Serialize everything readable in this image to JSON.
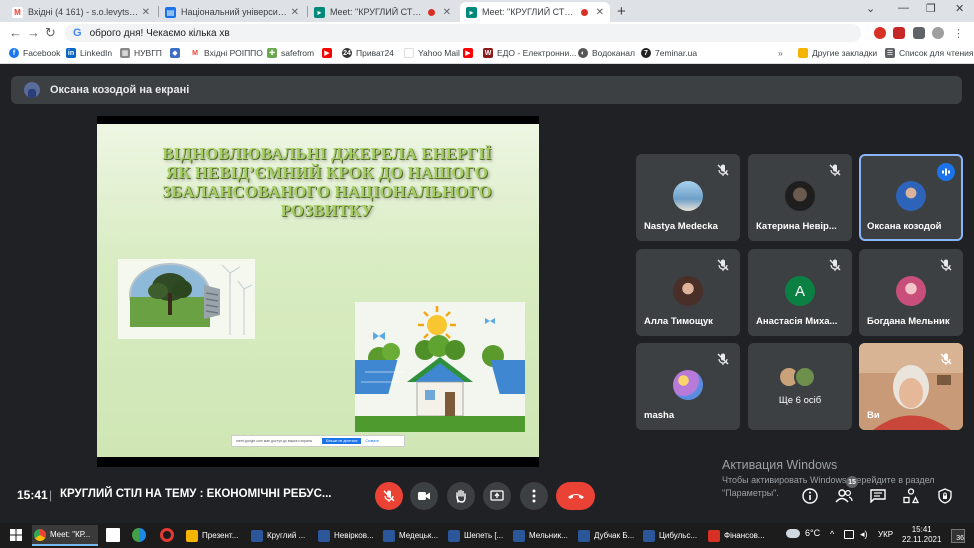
{
  "browser": {
    "tabs": [
      {
        "title": "Вхідні (4 161) - s.o.levytska@nu...",
        "icon": "gmail-icon"
      },
      {
        "title": "Національний університет вод...",
        "icon": "university-icon"
      },
      {
        "title": "Meet: \"КРУГЛИЙ СТІЛ НА ТЕ...",
        "icon": "meet-icon"
      },
      {
        "title": "Meet: \"КРУГЛИЙ СТІЛ НА ТЕ...",
        "icon": "meet-icon"
      }
    ],
    "new_tab": "+",
    "address": "оброго дня! Чекаємо кілька хв",
    "bookmarks": [
      {
        "label": "Facebook",
        "color": "#1877f2",
        "glyph": "f"
      },
      {
        "label": "LinkedIn",
        "color": "#0a66c2",
        "glyph": "in"
      },
      {
        "label": "НУВГП",
        "color": "#888888",
        "glyph": "▦"
      },
      {
        "label": "",
        "color": "#3c6ec8",
        "glyph": "◆"
      },
      {
        "label": "Вхідні РОІППО",
        "color": "#ea4335",
        "glyph": "M"
      },
      {
        "label": "safefrom",
        "color": "#6aa84f",
        "glyph": "✚"
      },
      {
        "label": "",
        "color": "#ff0000",
        "glyph": "▶"
      },
      {
        "label": "Приват24",
        "color": "#333333",
        "glyph": "24"
      },
      {
        "label": "Yahoo Mail",
        "color": "#ffffff",
        "glyph": ""
      },
      {
        "label": "",
        "color": "#ff0000",
        "glyph": "▶"
      },
      {
        "label": "ЕДО - Електронни...",
        "color": "#8b1a1a",
        "glyph": "W"
      },
      {
        "label": "Водоканал",
        "color": "#555555",
        "glyph": "◐"
      },
      {
        "label": "7eminar.ua",
        "color": "#222222",
        "glyph": "7"
      }
    ],
    "other_bookmarks": "Другие закладки",
    "reading_list": "Список для чтения"
  },
  "meet": {
    "presenter_label": "Оксана козодой на екрані",
    "slide": {
      "title_lines": [
        "ВІДНОВЛЮВАЛЬНІ ДЖЕРЕЛА ЕНЕРГІЇ",
        "ЯК НЕВІД’ЄМНИЙ КРОК ДО НАШОГО",
        "ЗБАЛАНСОВАНОГО НАЦІОНАЛЬНОГО",
        "РОЗВИТКУ"
      ],
      "notice_text": "meet.google.com має доступ до вашого екрана",
      "notice_stop": "Більше не ділитися",
      "notice_hide": "Сховати"
    },
    "participants": [
      {
        "name": "Nastya Medecka",
        "muted": true,
        "avatar_color": "#7fb6de"
      },
      {
        "name": "Катерина Невір...",
        "muted": true,
        "avatar_color": "#2b2b2b"
      },
      {
        "name": "Оксана козодой",
        "muted": false,
        "speaking": true,
        "avatar_color": "#2d63b8"
      },
      {
        "name": "Алла Тимощук",
        "muted": true,
        "avatar_color": "#8a5a4a"
      },
      {
        "name": "Анастасія Миха...",
        "muted": true,
        "avatar_letter": "А",
        "avatar_color": "#0b8043"
      },
      {
        "name": "Богдана Мельник",
        "muted": true,
        "avatar_color": "#d66a8a"
      },
      {
        "name": "masha",
        "muted": true,
        "avatar_color": "#b77ad8"
      },
      {
        "name": "",
        "more_label": "Ще 6 осіб"
      },
      {
        "name": "Ви",
        "muted": true,
        "video": true
      }
    ],
    "watermark": {
      "title": "Активация Windows",
      "line1": "Чтобы активировать Windows, перейдите в раздел",
      "line2": "\"Параметры\"."
    },
    "bottom": {
      "time": "15:41",
      "separator": "|",
      "meeting_title": "КРУГЛИЙ СТІЛ НА ТЕМУ : ЕКОНОМІЧНІ РЕБУС...",
      "people_count": "15"
    }
  },
  "taskbar": {
    "items": [
      {
        "label": "Meet: \"КР...",
        "color": "#4285f4",
        "active": true
      },
      {
        "label": "Презент...",
        "color": "#f4b400"
      },
      {
        "label": "Круглий ...",
        "color": "#2b579a"
      },
      {
        "label": "Невірков...",
        "color": "#2b579a"
      },
      {
        "label": "Медецьк...",
        "color": "#2b579a"
      },
      {
        "label": "Шепеть [...",
        "color": "#2b579a"
      },
      {
        "label": "Мельник...",
        "color": "#2b579a"
      },
      {
        "label": "Дубчак Б...",
        "color": "#2b579a"
      },
      {
        "label": "Цибульс...",
        "color": "#2b579a"
      },
      {
        "label": "Фінансов...",
        "color": "#d93025"
      }
    ],
    "weather": "6°C",
    "lang": "УКР",
    "clock_time": "15:41",
    "clock_date": "22.11.2021",
    "notifications": "36"
  }
}
